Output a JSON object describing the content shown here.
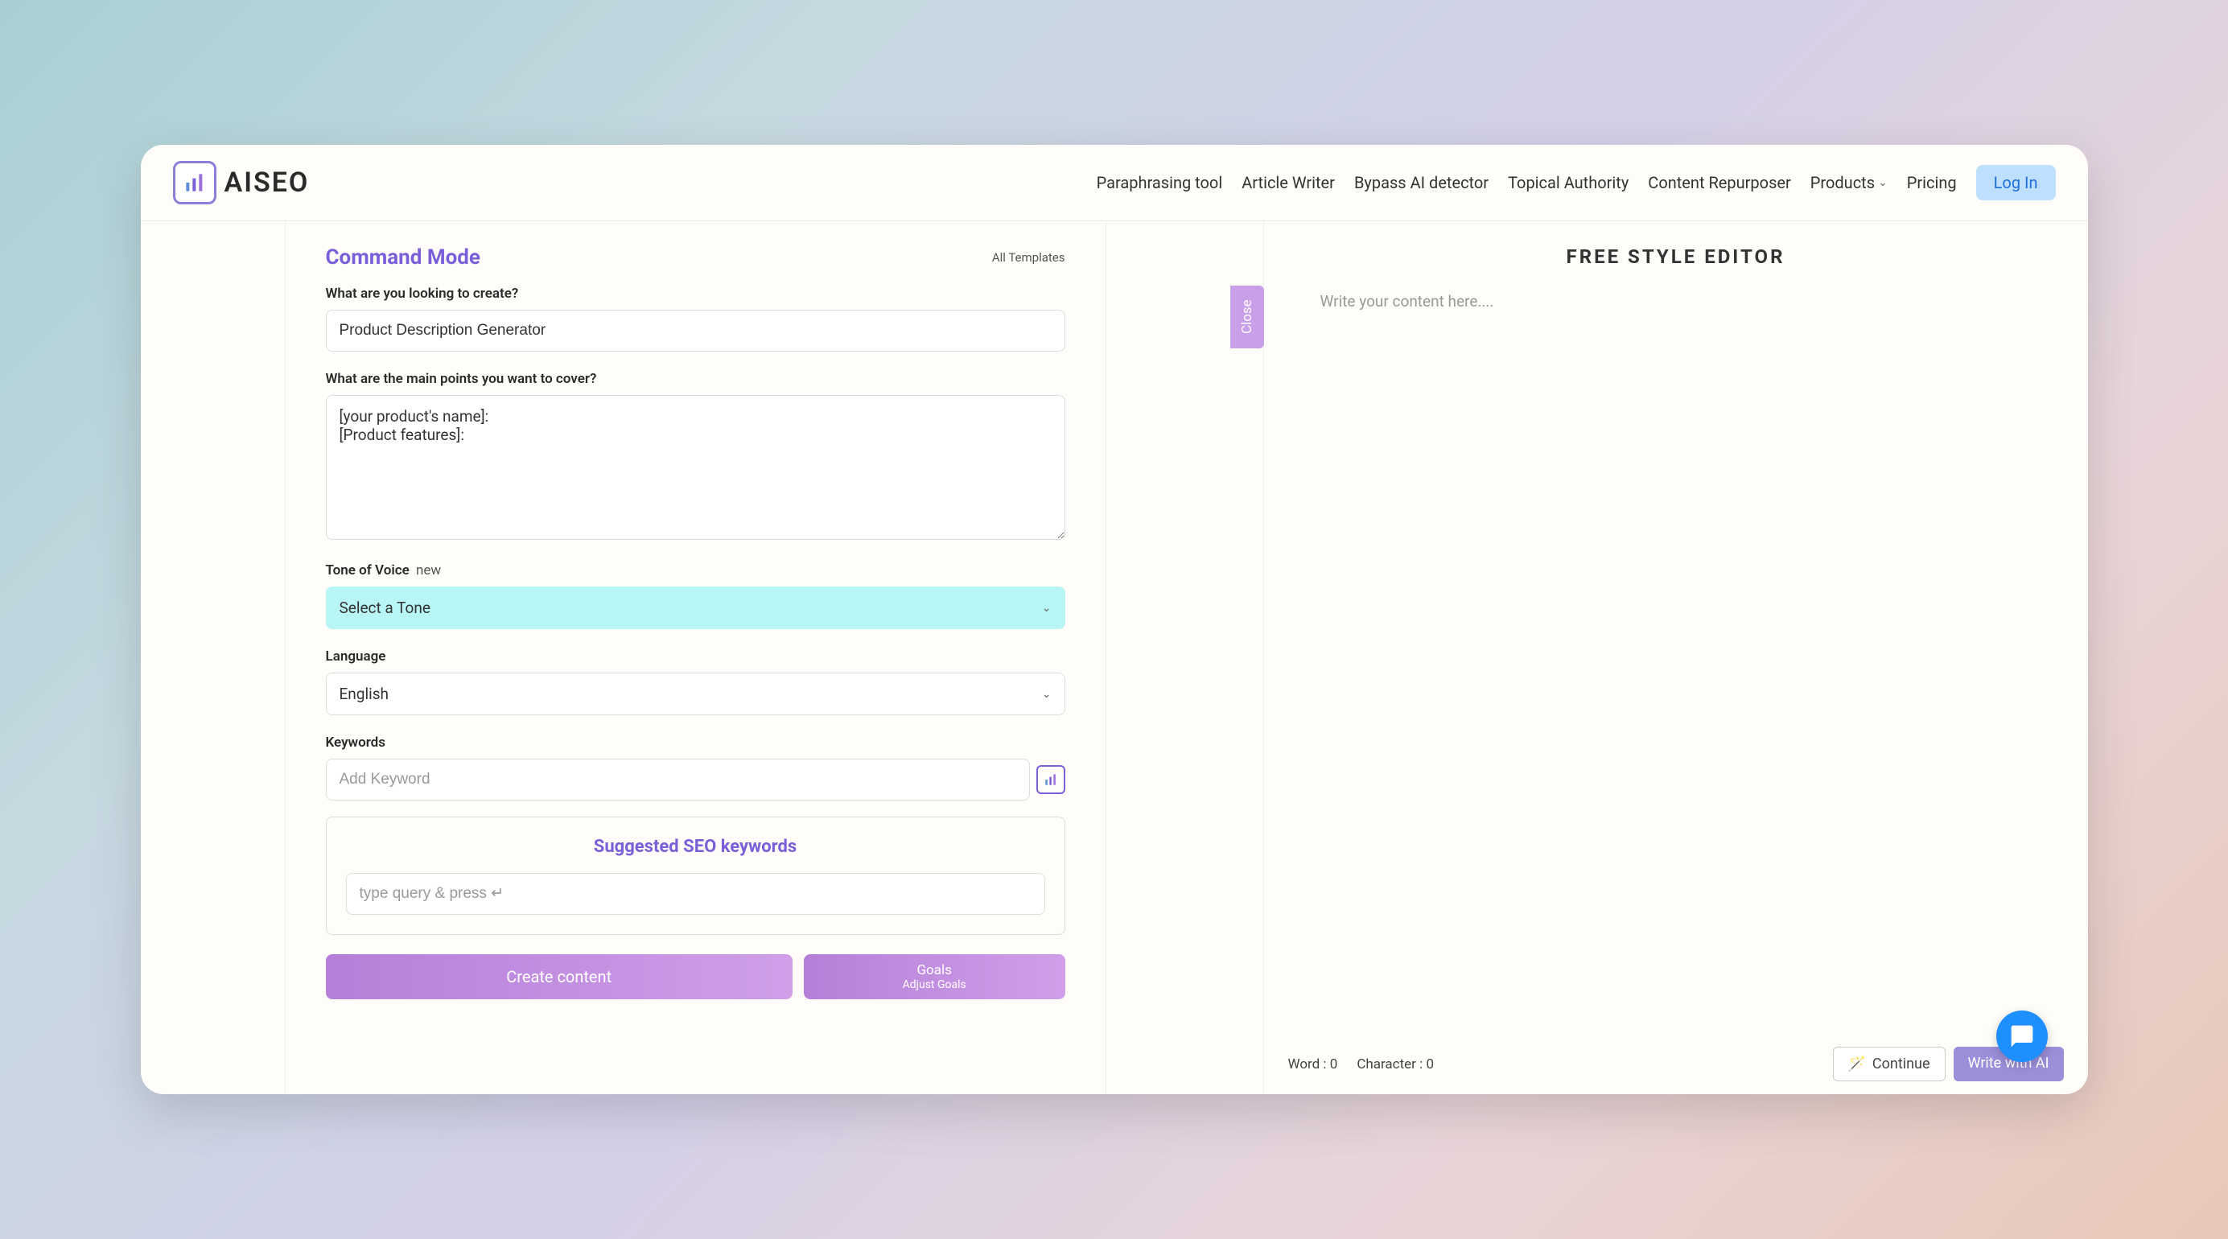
{
  "brand": "AISEO",
  "nav": {
    "items": [
      "Paraphrasing tool",
      "Article Writer",
      "Bypass AI detector",
      "Topical Authority",
      "Content Repurposer"
    ],
    "products": "Products",
    "pricing": "Pricing",
    "login": "Log In"
  },
  "cmd": {
    "title": "Command Mode",
    "all_templates": "All Templates",
    "q1_label": "What are you looking to create?",
    "q1_value": "Product Description Generator",
    "q2_label": "What are the main points you want to cover?",
    "q2_value": "[your product's name]:\n[Product features]:",
    "tone_label": "Tone of Voice",
    "tone_new": "new",
    "tone_placeholder": "Select a Tone",
    "lang_label": "Language",
    "lang_value": "English",
    "kw_label": "Keywords",
    "kw_placeholder": "Add Keyword",
    "seo_title": "Suggested SEO keywords",
    "seo_placeholder": "type query & press ↵",
    "create_btn": "Create content",
    "goals_btn": "Goals",
    "goals_sub": "Adjust Goals"
  },
  "editor": {
    "title": "FREE STYLE EDITOR",
    "placeholder": "Write your content here....",
    "close": "Close",
    "word_label": "Word :",
    "word_val": "0",
    "char_label": "Character :",
    "char_val": "0",
    "continue": "Continue",
    "write_ai": "Write with AI"
  }
}
